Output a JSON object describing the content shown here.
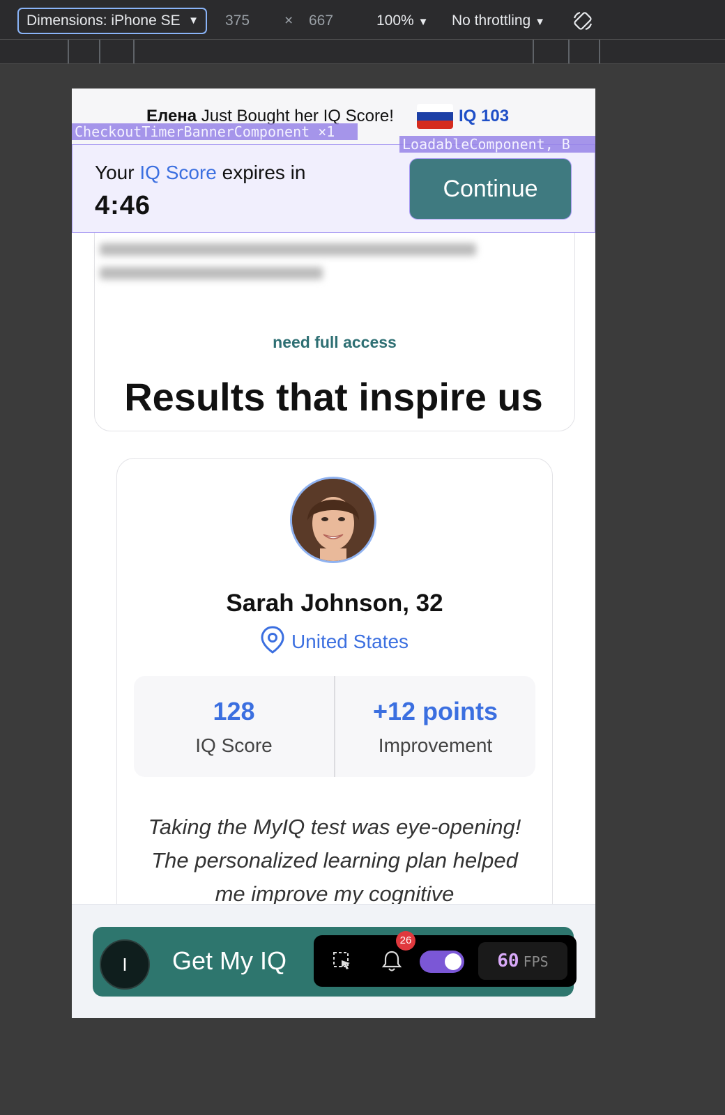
{
  "devtools": {
    "dimensions_select": "Dimensions: iPhone SE",
    "width": "375",
    "times": "×",
    "height": "667",
    "zoom": "100%",
    "throttling": "No throttling"
  },
  "ticker": {
    "buyer_name": "Елена",
    "message": " Just Bought her IQ Score!",
    "iq_value": "IQ 103",
    "flag": [
      "#ffffff",
      "#1c3fa6",
      "#d52b1e"
    ]
  },
  "debug_overlays": {
    "timer_component": "CheckoutTimerBannerComponent ×1",
    "loadable_component": "LoadableComponent, B"
  },
  "timer_banner": {
    "prefix": "Your ",
    "highlight": "IQ Score",
    "suffix": " expires in",
    "countdown": "4:46",
    "continue_label": "Continue"
  },
  "locked_card": {
    "access_text": "need full access"
  },
  "results": {
    "title": "Results that inspire us"
  },
  "testimonial": {
    "name": "Sarah Johnson, 32",
    "location": "United States",
    "stats": [
      {
        "value": "128",
        "caption": "IQ Score"
      },
      {
        "value": "+12 points",
        "caption": "Improvement"
      }
    ],
    "quote": "Taking the MyIQ test was eye-opening! The personalized learning plan helped me improve my cognitive"
  },
  "footer": {
    "cta_icon_letter": "I",
    "cta_label": "Get My IQ"
  },
  "perf_toolbar": {
    "notification_count": "26",
    "fps_value": "60",
    "fps_unit": "FPS"
  },
  "colors": {
    "accent_blue": "#3b6fe0",
    "cta_teal": "#2e766e",
    "continue_teal": "#3f7a80",
    "overlay_purple": "#a79af2"
  }
}
